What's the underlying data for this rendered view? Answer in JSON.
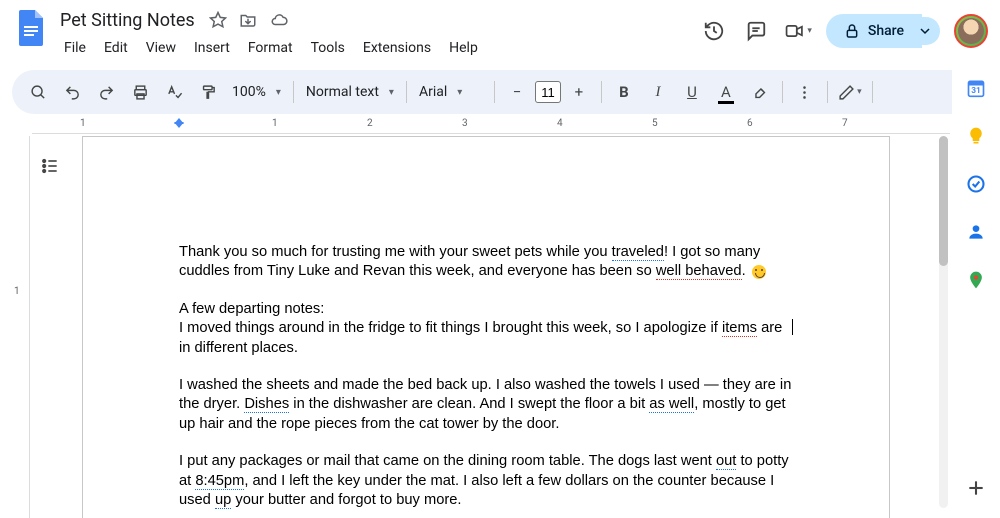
{
  "doc_title": "Pet Sitting Notes",
  "menu": [
    "File",
    "Edit",
    "View",
    "Insert",
    "Format",
    "Tools",
    "Extensions",
    "Help"
  ],
  "share_label": "Share",
  "toolbar": {
    "zoom": "100%",
    "style": "Normal text",
    "font": "Arial",
    "font_size": "11"
  },
  "ruler_numbers": [
    "1",
    "1",
    "2",
    "3",
    "4",
    "5",
    "6",
    "7"
  ],
  "document_body": {
    "para1_a": "Thank you so much for trusting me with your sweet pets while you ",
    "traveled": "traveled",
    "para1_b": "! I got so many cuddles from Tiny Luke and Revan this week, and everyone has been so ",
    "well_behaved": "well behaved",
    "para1_c": ". ",
    "para2": "A few departing notes:",
    "para2b_a": "I moved things around in the fridge to fit things I brought this week, so I apologize if ",
    "items": "items",
    "para2b_b": " are in different places.",
    "para3_a": "I washed the sheets and made the bed back up. I also washed the towels I used — they are in the dryer. ",
    "dishes": "Dishes",
    "para3_b": " in the dishwasher are clean. And I swept the floor a bit ",
    "as_well": "as well",
    "para3_c": ", mostly to get up hair and the rope pieces from the cat tower by the door.",
    "para4_a": "I put any packages or mail that came on the dining room table. The dogs last went ",
    "out": "out",
    "para4_b": " to potty at ",
    "time": "8:45pm",
    "para4_c": ", and I left the key under the mat. I also left a few dollars on the counter because I used ",
    "up": "up",
    "para4_d": " your butter and forgot to buy more."
  }
}
